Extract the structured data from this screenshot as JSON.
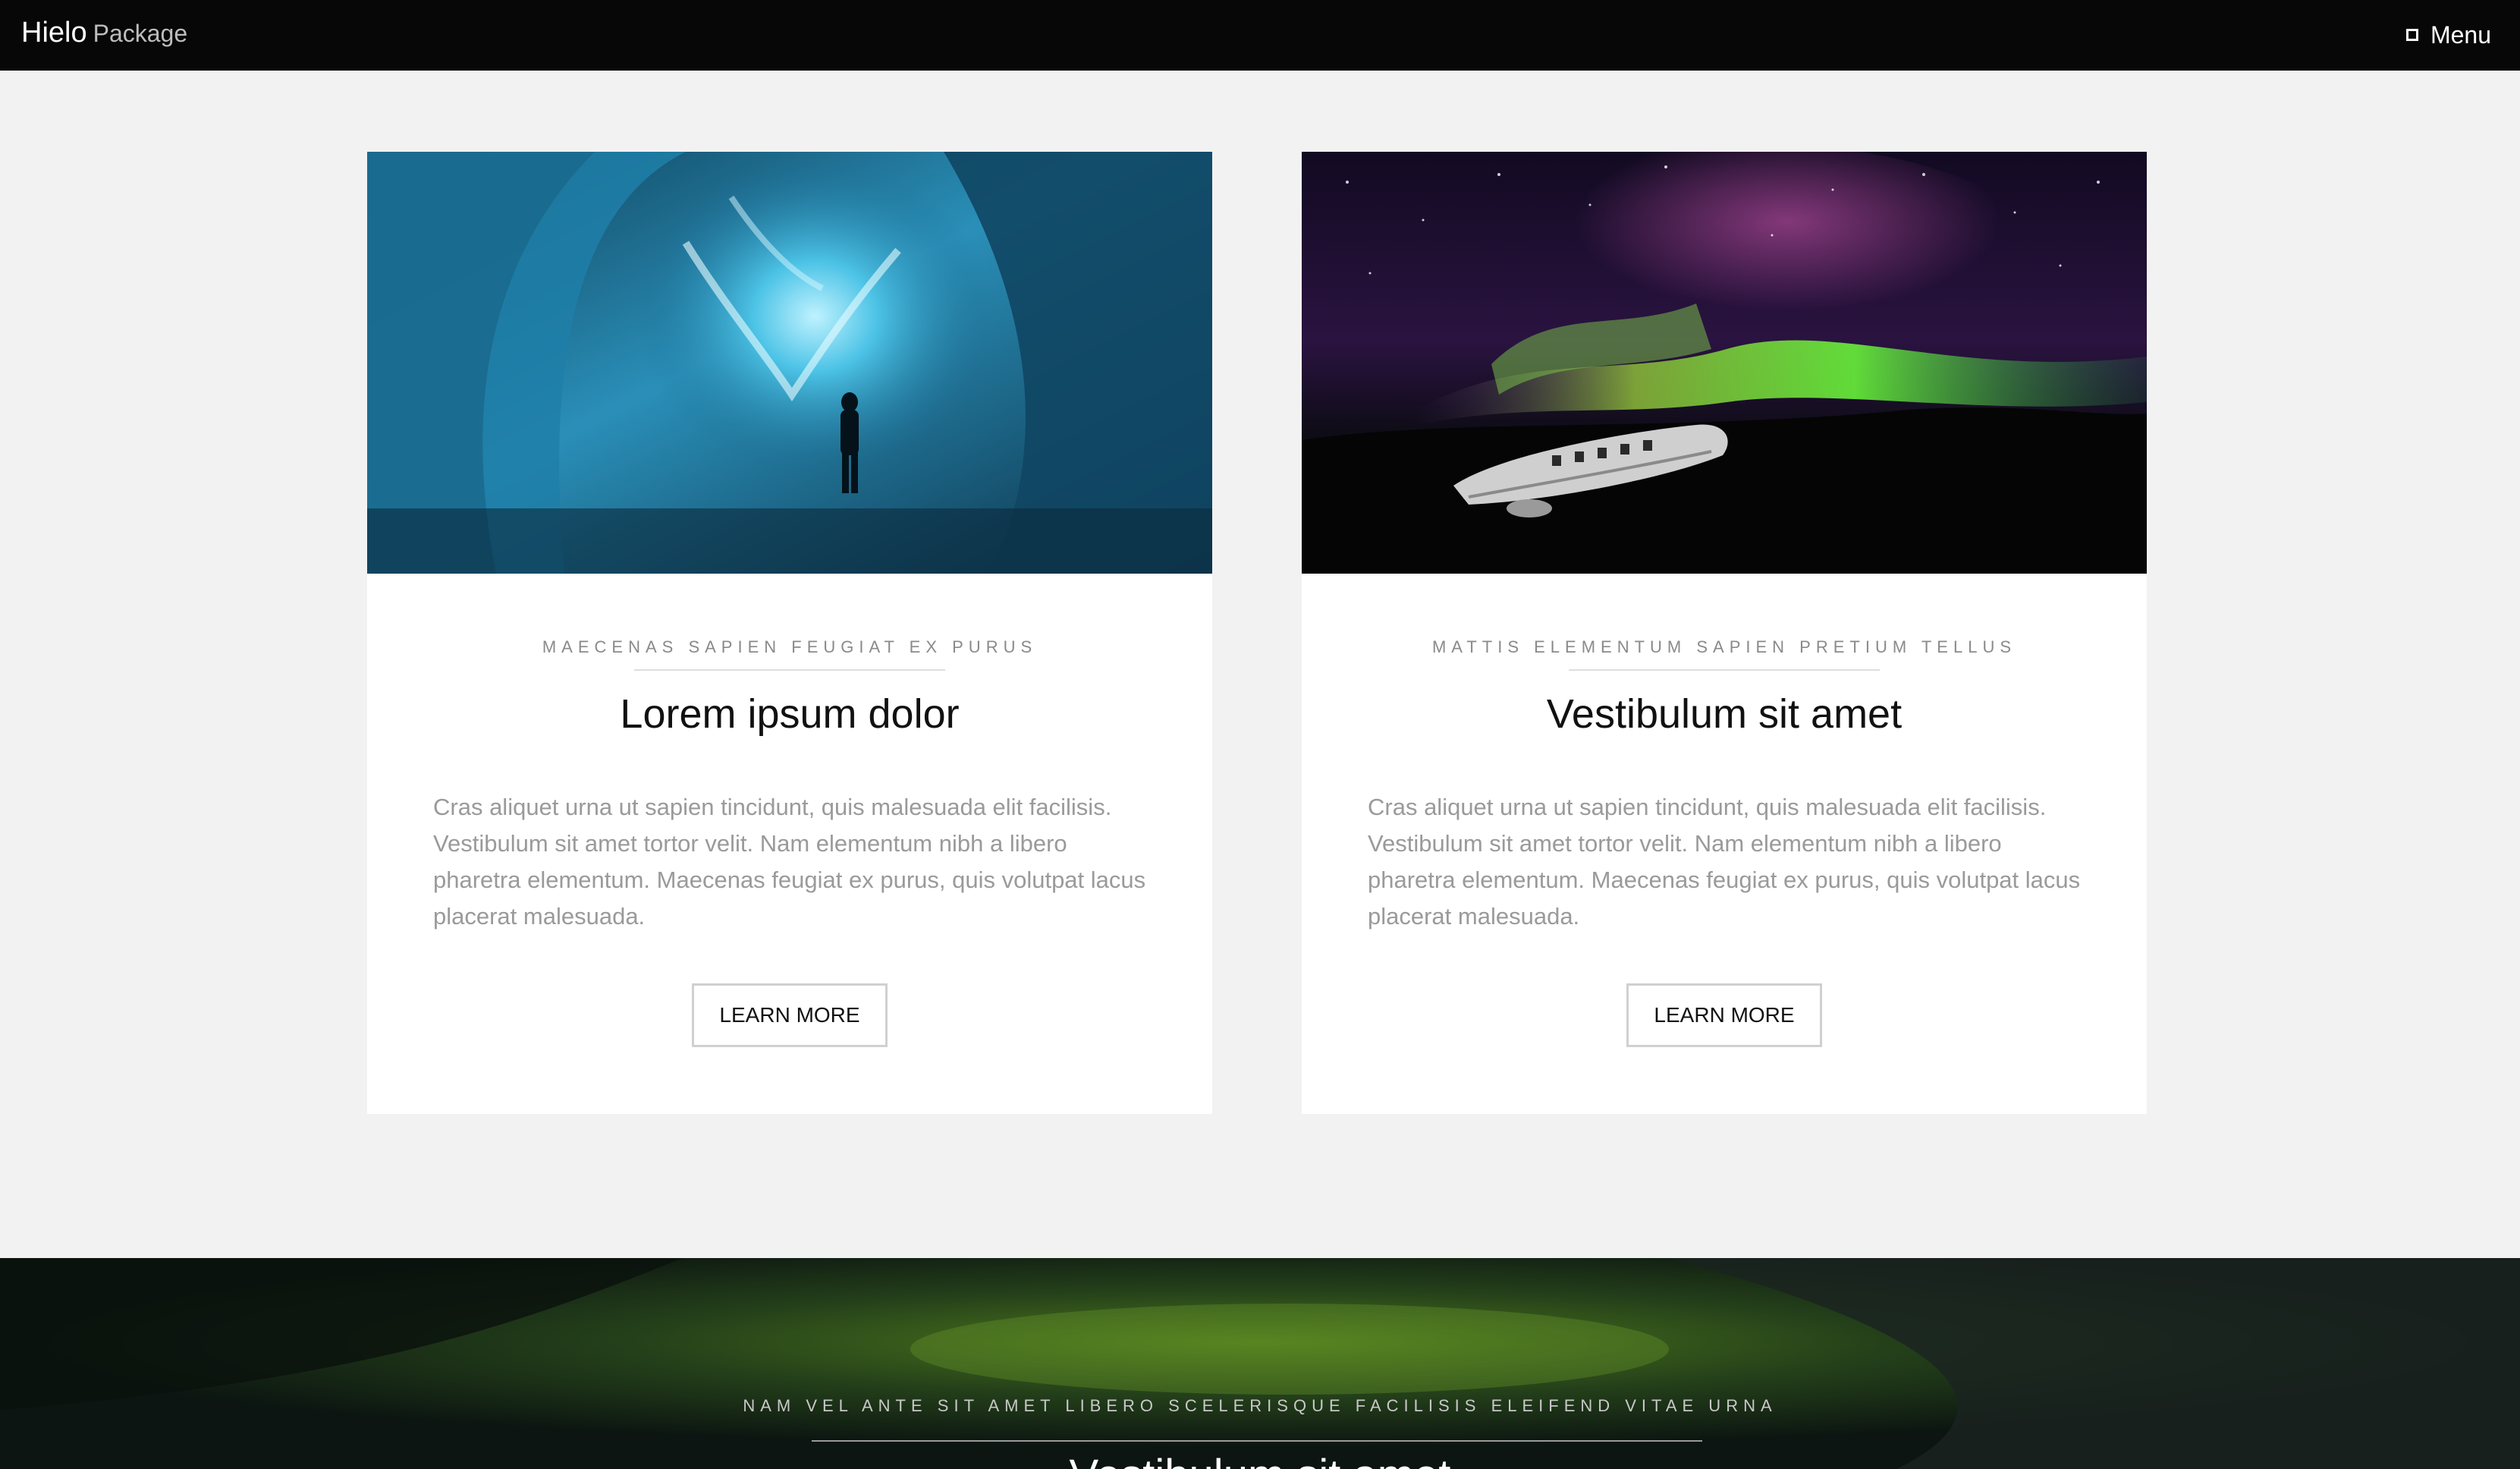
{
  "header": {
    "logo_main": "Hielo",
    "logo_sub": "Package",
    "menu_label": "Menu",
    "menu_icon": "square-icon"
  },
  "cards": [
    {
      "image": "ice-cave-photo",
      "kicker": "MAECENAS SAPIEN FEUGIAT EX PURUS",
      "title": "Lorem ipsum dolor",
      "text": "Cras aliquet urna ut sapien tincidunt, quis malesuada elit facilisis. Vestibulum sit amet tortor velit. Nam elementum nibh a libero pharetra elementum. Maecenas feugiat ex purus, quis volutpat lacus placerat malesuada.",
      "button": "LEARN MORE"
    },
    {
      "image": "aurora-plane-wreck-photo",
      "kicker": "MATTIS ELEMENTUM SAPIEN PRETIUM TELLUS",
      "title": "Vestibulum sit amet",
      "text": "Cras aliquet urna ut sapien tincidunt, quis malesuada elit facilisis. Vestibulum sit amet tortor velit. Nam elementum nibh a libero pharetra elementum. Maecenas feugiat ex purus, quis volutpat lacus placerat malesuada.",
      "button": "LEARN MORE"
    }
  ],
  "banner": {
    "kicker": "NAM VEL ANTE SIT AMET LIBERO SCELERISQUE FACILISIS ELEIFEND VITAE URNA",
    "title": "Vestibulum sit amet"
  },
  "colors": {
    "header_bg": "#070707",
    "page_bg": "#f2f2f2",
    "card_bg": "#ffffff",
    "ice_blue": "#3aaed0",
    "aurora_green": "#6cff3a"
  }
}
